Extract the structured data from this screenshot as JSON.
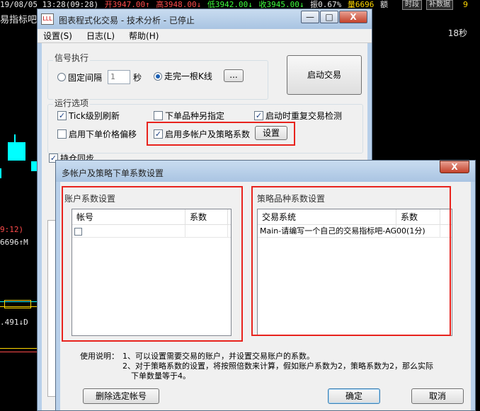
{
  "ticker": {
    "date": "19/08/05 13:28(09:28)",
    "open": "开3947.00↑",
    "high": "高3948.00↓",
    "low": "低3942.00↓",
    "close": "收3945.00↓",
    "change": "振0.67%",
    "volume": "量6696",
    "tail": "额",
    "btn_timeframe": "时段",
    "btn_supplement": "补数据",
    "right_num": "9"
  },
  "chart_side": {
    "title": "易指标吧",
    "label1": "9:12)",
    "label2": "6696↑M",
    "label3": ".491↓D",
    "countdown": "18秒"
  },
  "main_window": {
    "icon_text": "LLL",
    "title": "图表程式化交易 - 技术分析 - 已停止",
    "minimize": "—",
    "maximize": "□",
    "close": "X",
    "menu": [
      "设置(S)",
      "日志(L)",
      "帮助(H)"
    ],
    "signal_group": "信号执行",
    "fixed_interval": "固定间隔",
    "interval_value": "1",
    "seconds": "秒",
    "bar_close": "走完一根K线",
    "ellipsis": "...",
    "start_trading": "启动交易",
    "options_group": "运行选项",
    "tick_refresh": "Tick级别刷新",
    "place_order_other": "下单品种另指定",
    "repeat_check": "启动时重复交易检测",
    "price_offset": "启用下单价格偏移",
    "multi_account": "启用多帐户及策略系数",
    "settings_button": "设置",
    "position_sync": "持仓同步"
  },
  "dialog": {
    "title": "多帐户及策略下单系数设置",
    "close": "X",
    "account_group": "账户系数设置",
    "account_columns": [
      "帐号",
      "系数"
    ],
    "strategy_group": "策略品种系数设置",
    "strategy_columns": [
      "交易系统",
      "系数"
    ],
    "strategy_rows": [
      {
        "system": "Main-请编写一个自己的交易指标吧-AG00(1分)",
        "coef": ""
      }
    ],
    "instructions_label": "使用说明：",
    "instruction1": "1、可以设置需要交易的账户，并设置交易账户的系数。",
    "instruction2": "2、对于策略系数的设置，将按照倍数来计算，假如账户系数为2，策略系数为2，那么实际",
    "instruction3": "下单数量等于4。",
    "delete_button": "删除选定帐号",
    "ok_button": "确定",
    "cancel_button": "取消"
  },
  "colors": {
    "highlight_red": "#e8231d",
    "titlebar_blue": "#b8d0ea",
    "close_red": "#c3412a",
    "chart_cyan": "#00ffff"
  }
}
